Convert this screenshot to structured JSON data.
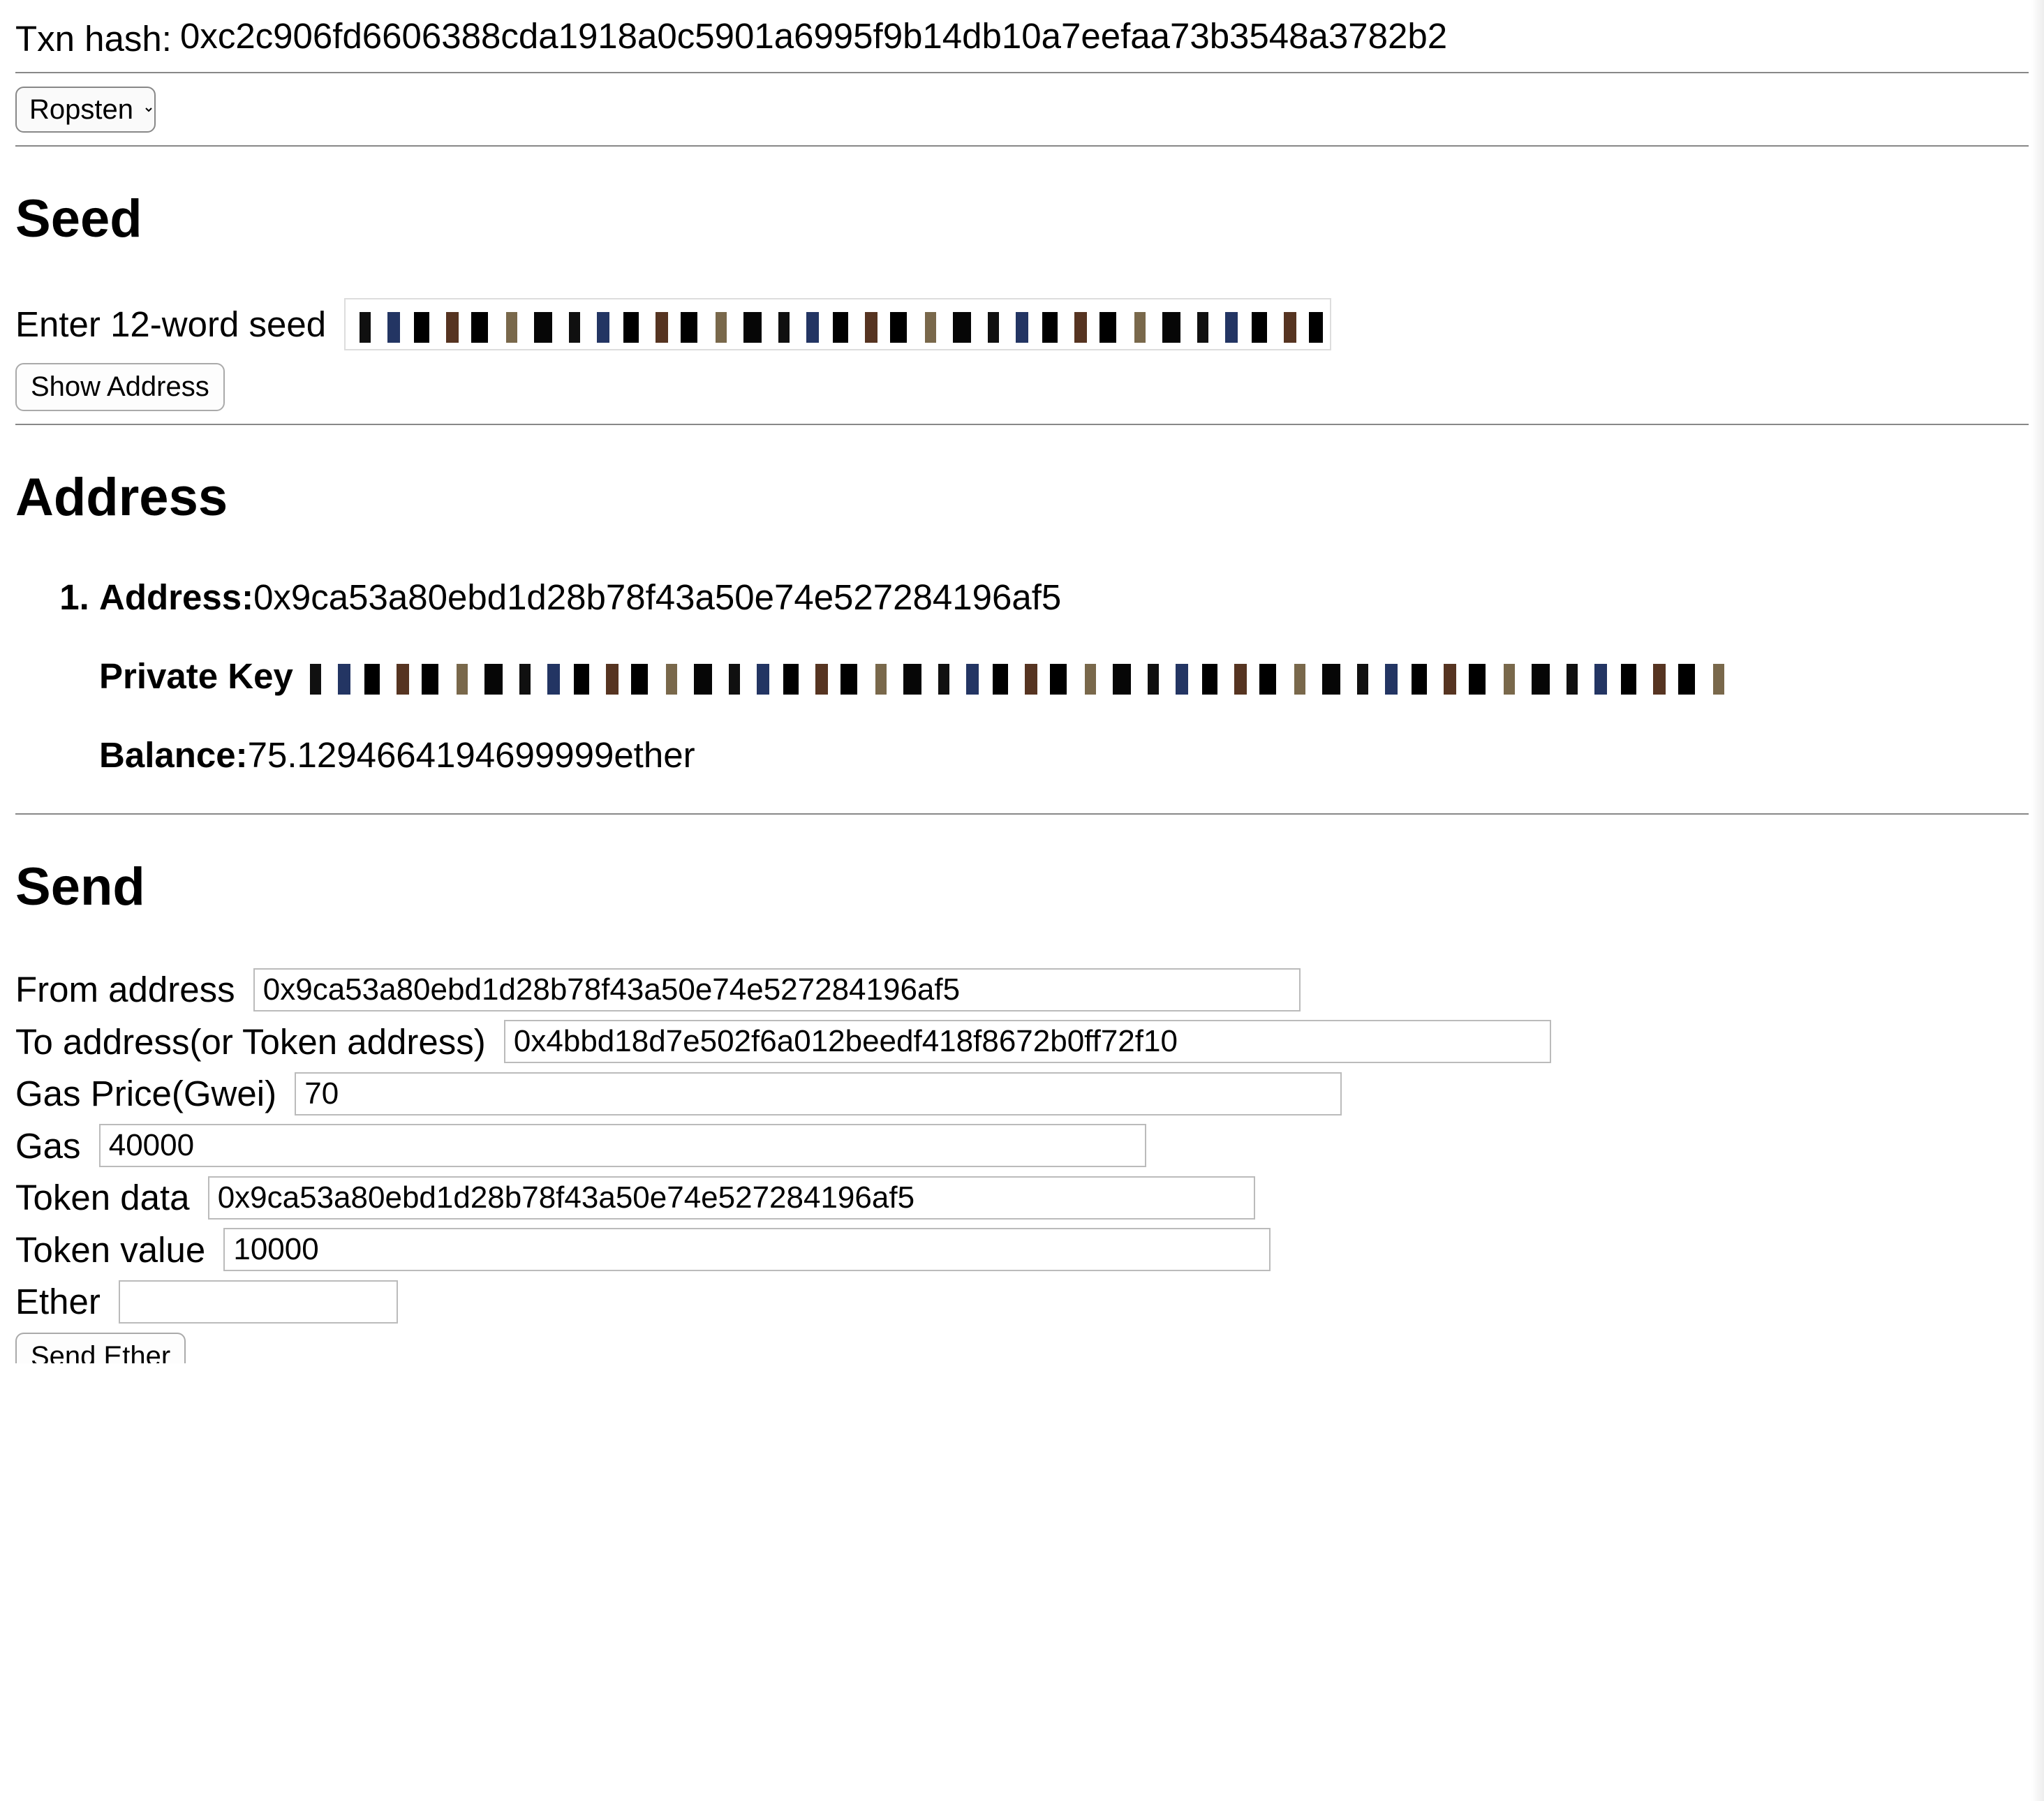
{
  "txn": {
    "label": "Txn hash: ",
    "hash": "0xc2c906fd6606388cda1918a0c5901a6995f9b14db10a7eefaa73b3548a3782b2"
  },
  "network": {
    "selected": "Ropsten"
  },
  "seed": {
    "heading": "Seed",
    "prompt": "Enter 12-word seed",
    "show_button": "Show Address"
  },
  "address": {
    "heading": "Address",
    "items": [
      {
        "address_label": "Address:",
        "address": "0x9ca53a80ebd1d28b78f43a50e74e527284196af5",
        "private_key_label": "Private Key",
        "balance_label": "Balance:",
        "balance_value": "75.1294664194699999",
        "balance_unit": "ether"
      }
    ]
  },
  "send": {
    "heading": "Send",
    "from_label": "From address",
    "from_value": "0x9ca53a80ebd1d28b78f43a50e74e527284196af5",
    "to_label": "To address(or Token address)",
    "to_value": "0x4bbd18d7e502f6a012beedf418f8672b0ff72f10",
    "gas_price_label": "Gas Price(Gwei)",
    "gas_price_value": "70",
    "gas_label": "Gas",
    "gas_value": "40000",
    "token_data_label": "Token data",
    "token_data_value": "0x9ca53a80ebd1d28b78f43a50e74e527284196af5",
    "token_value_label": "Token value",
    "token_value_value": "10000",
    "ether_label": "Ether",
    "ether_value": "",
    "send_button": "Send Ether"
  }
}
